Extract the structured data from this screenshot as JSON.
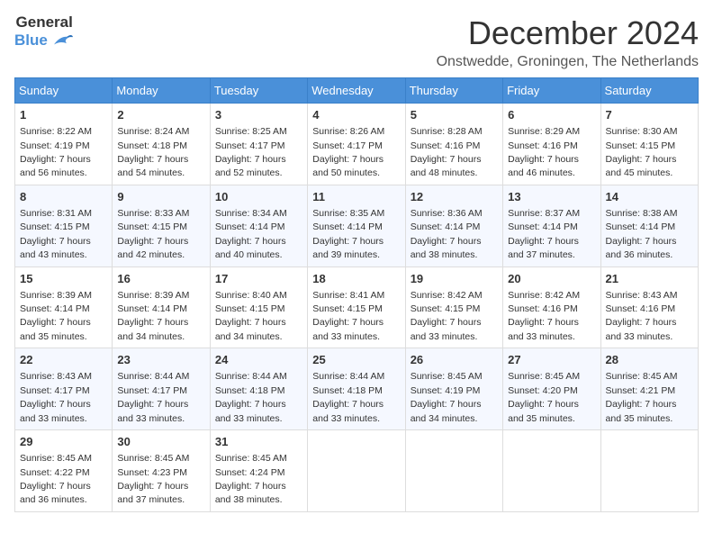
{
  "logo": {
    "general": "General",
    "blue": "Blue"
  },
  "title": "December 2024",
  "subtitle": "Onstwedde, Groningen, The Netherlands",
  "days_of_week": [
    "Sunday",
    "Monday",
    "Tuesday",
    "Wednesday",
    "Thursday",
    "Friday",
    "Saturday"
  ],
  "weeks": [
    [
      {
        "day": "1",
        "sunrise": "8:22 AM",
        "sunset": "4:19 PM",
        "daylight": "7 hours and 56 minutes."
      },
      {
        "day": "2",
        "sunrise": "8:24 AM",
        "sunset": "4:18 PM",
        "daylight": "7 hours and 54 minutes."
      },
      {
        "day": "3",
        "sunrise": "8:25 AM",
        "sunset": "4:17 PM",
        "daylight": "7 hours and 52 minutes."
      },
      {
        "day": "4",
        "sunrise": "8:26 AM",
        "sunset": "4:17 PM",
        "daylight": "7 hours and 50 minutes."
      },
      {
        "day": "5",
        "sunrise": "8:28 AM",
        "sunset": "4:16 PM",
        "daylight": "7 hours and 48 minutes."
      },
      {
        "day": "6",
        "sunrise": "8:29 AM",
        "sunset": "4:16 PM",
        "daylight": "7 hours and 46 minutes."
      },
      {
        "day": "7",
        "sunrise": "8:30 AM",
        "sunset": "4:15 PM",
        "daylight": "7 hours and 45 minutes."
      }
    ],
    [
      {
        "day": "8",
        "sunrise": "8:31 AM",
        "sunset": "4:15 PM",
        "daylight": "7 hours and 43 minutes."
      },
      {
        "day": "9",
        "sunrise": "8:33 AM",
        "sunset": "4:15 PM",
        "daylight": "7 hours and 42 minutes."
      },
      {
        "day": "10",
        "sunrise": "8:34 AM",
        "sunset": "4:14 PM",
        "daylight": "7 hours and 40 minutes."
      },
      {
        "day": "11",
        "sunrise": "8:35 AM",
        "sunset": "4:14 PM",
        "daylight": "7 hours and 39 minutes."
      },
      {
        "day": "12",
        "sunrise": "8:36 AM",
        "sunset": "4:14 PM",
        "daylight": "7 hours and 38 minutes."
      },
      {
        "day": "13",
        "sunrise": "8:37 AM",
        "sunset": "4:14 PM",
        "daylight": "7 hours and 37 minutes."
      },
      {
        "day": "14",
        "sunrise": "8:38 AM",
        "sunset": "4:14 PM",
        "daylight": "7 hours and 36 minutes."
      }
    ],
    [
      {
        "day": "15",
        "sunrise": "8:39 AM",
        "sunset": "4:14 PM",
        "daylight": "7 hours and 35 minutes."
      },
      {
        "day": "16",
        "sunrise": "8:39 AM",
        "sunset": "4:14 PM",
        "daylight": "7 hours and 34 minutes."
      },
      {
        "day": "17",
        "sunrise": "8:40 AM",
        "sunset": "4:15 PM",
        "daylight": "7 hours and 34 minutes."
      },
      {
        "day": "18",
        "sunrise": "8:41 AM",
        "sunset": "4:15 PM",
        "daylight": "7 hours and 33 minutes."
      },
      {
        "day": "19",
        "sunrise": "8:42 AM",
        "sunset": "4:15 PM",
        "daylight": "7 hours and 33 minutes."
      },
      {
        "day": "20",
        "sunrise": "8:42 AM",
        "sunset": "4:16 PM",
        "daylight": "7 hours and 33 minutes."
      },
      {
        "day": "21",
        "sunrise": "8:43 AM",
        "sunset": "4:16 PM",
        "daylight": "7 hours and 33 minutes."
      }
    ],
    [
      {
        "day": "22",
        "sunrise": "8:43 AM",
        "sunset": "4:17 PM",
        "daylight": "7 hours and 33 minutes."
      },
      {
        "day": "23",
        "sunrise": "8:44 AM",
        "sunset": "4:17 PM",
        "daylight": "7 hours and 33 minutes."
      },
      {
        "day": "24",
        "sunrise": "8:44 AM",
        "sunset": "4:18 PM",
        "daylight": "7 hours and 33 minutes."
      },
      {
        "day": "25",
        "sunrise": "8:44 AM",
        "sunset": "4:18 PM",
        "daylight": "7 hours and 33 minutes."
      },
      {
        "day": "26",
        "sunrise": "8:45 AM",
        "sunset": "4:19 PM",
        "daylight": "7 hours and 34 minutes."
      },
      {
        "day": "27",
        "sunrise": "8:45 AM",
        "sunset": "4:20 PM",
        "daylight": "7 hours and 35 minutes."
      },
      {
        "day": "28",
        "sunrise": "8:45 AM",
        "sunset": "4:21 PM",
        "daylight": "7 hours and 35 minutes."
      }
    ],
    [
      {
        "day": "29",
        "sunrise": "8:45 AM",
        "sunset": "4:22 PM",
        "daylight": "7 hours and 36 minutes."
      },
      {
        "day": "30",
        "sunrise": "8:45 AM",
        "sunset": "4:23 PM",
        "daylight": "7 hours and 37 minutes."
      },
      {
        "day": "31",
        "sunrise": "8:45 AM",
        "sunset": "4:24 PM",
        "daylight": "7 hours and 38 minutes."
      },
      null,
      null,
      null,
      null
    ]
  ]
}
